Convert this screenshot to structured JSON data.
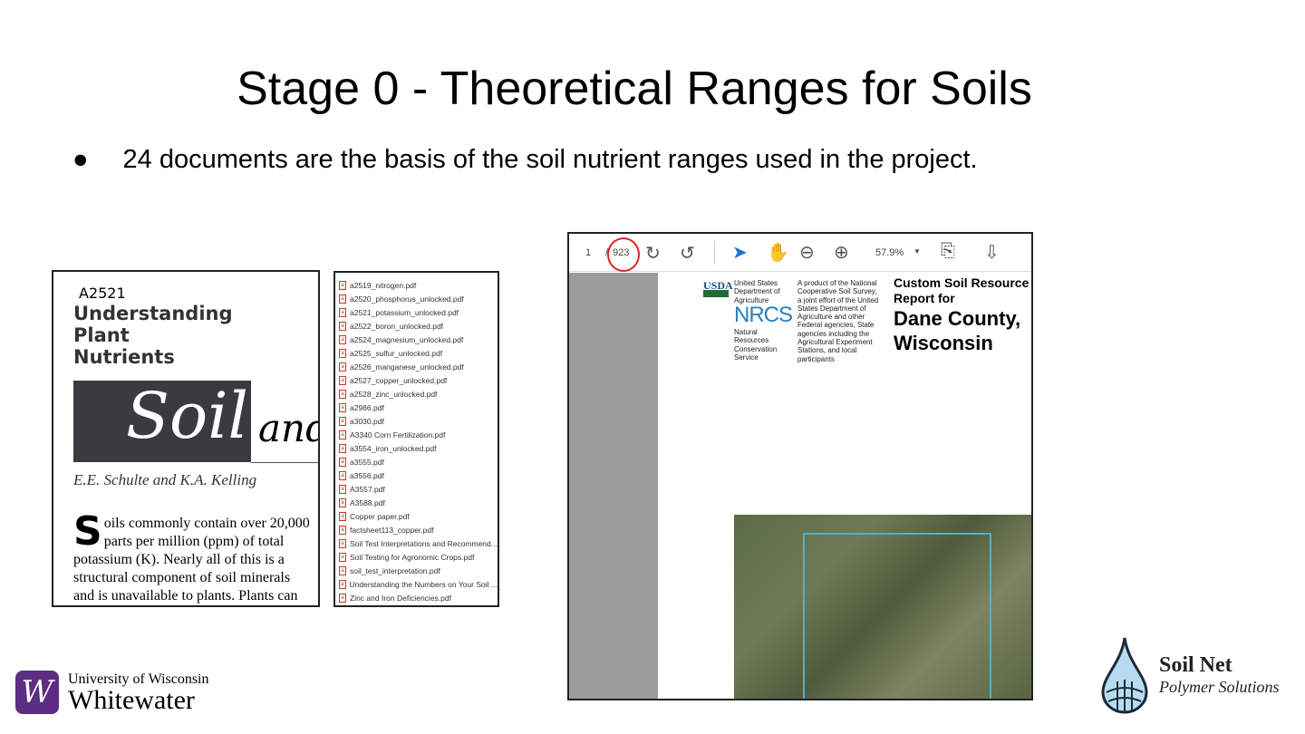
{
  "slide": {
    "title": "Stage 0 - Theoretical Ranges for Soils",
    "bullet_marker": "●",
    "bullet": "24 documents are the basis of the soil nutrient ranges used in the project."
  },
  "doc_cover": {
    "code": "A2521",
    "heading": [
      "Understanding",
      "Plant",
      "Nutrients"
    ],
    "soil": "Soil",
    "and": "and",
    "authors": "E.E. Schulte and K.A. Kelling",
    "drop_cap": "S",
    "body": [
      "oils commonly contain over 20,000",
      "parts per million (ppm) of total",
      "potassium (K). Nearly all of this is a",
      "structural component of soil minerals",
      "and is unavailable to plants. Plants can"
    ]
  },
  "files": [
    "a2519_nitrogen.pdf",
    "a2520_phosphorus_unlocked.pdf",
    "a2521_potassium_unlocked.pdf",
    "a2522_boron_unlocked.pdf",
    "a2524_magnesium_unlocked.pdf",
    "a2525_sulfur_unlocked.pdf",
    "a2526_manganese_unlocked.pdf",
    "a2527_copper_unlocked.pdf",
    "a2528_zinc_unlocked.pdf",
    "a2986.pdf",
    "a3030.pdf",
    "A3340 Corn Fertilization.pdf",
    "a3554_iron_unlocked.pdf",
    "a3555.pdf",
    "a3556.pdf",
    "A3557.pdf",
    "A3588.pdf",
    "Copper paper.pdf",
    "factsheet113_copper.pdf",
    "Soil Test Interpretations and Recommend...",
    "Soil Testing for Agronomic Crops.pdf",
    "soil_test_interpretation.pdf",
    "Understanding the Numbers on Your Soil ...",
    "Zinc and Iron Deficiencies.pdf"
  ],
  "viewer": {
    "page": "1",
    "sep": "/",
    "total_pages": "923",
    "zoom": "57.9%",
    "usda": "USDA",
    "usda_text": [
      "United States",
      "Department of",
      "Agriculture"
    ],
    "nrcs": "NRCS",
    "nrcs_text": [
      "Natural",
      "Resources",
      "Conservation",
      "Service"
    ],
    "product_text": [
      "A product of the National",
      "Cooperative Soil Survey,",
      "a joint effort of the United",
      "States Department of",
      "Agriculture and other",
      "Federal agencies, State",
      "agencies including the",
      "Agricultural Experiment",
      "Stations, and local",
      "participants"
    ],
    "report_title": [
      "Custom Soil Resource",
      "Report for"
    ],
    "county": [
      "Dane County,",
      "Wisconsin"
    ]
  },
  "logos": {
    "uw": [
      "University of Wisconsin",
      "Whitewater"
    ],
    "uw_mark": "W",
    "soilnet": [
      "Soil Net",
      "Polymer Solutions"
    ]
  },
  "colors": {
    "annotation_circle": "#dd2222",
    "uw_purple": "#5c2d82",
    "nrcs_blue": "#2a7fc0"
  }
}
